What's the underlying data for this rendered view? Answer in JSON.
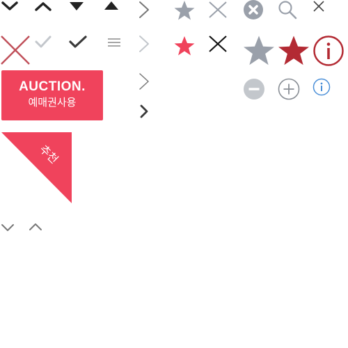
{
  "auction_badge": {
    "brand": "AUCTION.",
    "subtitle": "예매권사용",
    "color": "#f0435c"
  },
  "recommend_corner": {
    "label": "추천",
    "color": "#f0435c"
  },
  "icon_sheet": {
    "row_1": [
      "chevron-down-icon",
      "chevron-up-icon",
      "caret-down-icon",
      "caret-up-icon",
      "chevron-right-icon",
      "star-icon",
      "close-icon",
      "close-circle-icon",
      "search-icon",
      "close-icon"
    ],
    "row_2": [
      "close-icon",
      "check-icon",
      "check-icon",
      "menu-icon",
      "chevron-right-icon",
      "star-icon",
      "close-icon",
      "star-icon",
      "star-icon",
      "info-circle-icon"
    ],
    "row_3": [
      "chevron-right-icon",
      "minus-circle-icon",
      "plus-circle-icon",
      "info-circle-icon"
    ],
    "row_4": [
      "chevron-right-icon"
    ],
    "row_5": [
      "chevron-down-icon",
      "chevron-up-icon"
    ],
    "colors": {
      "dark": "#222222",
      "gray": "#9aa0aa",
      "light_gray": "#c3c7cc",
      "red": "#f0435c",
      "dark_red": "#b32a33",
      "blue": "#4a8fd8"
    }
  }
}
